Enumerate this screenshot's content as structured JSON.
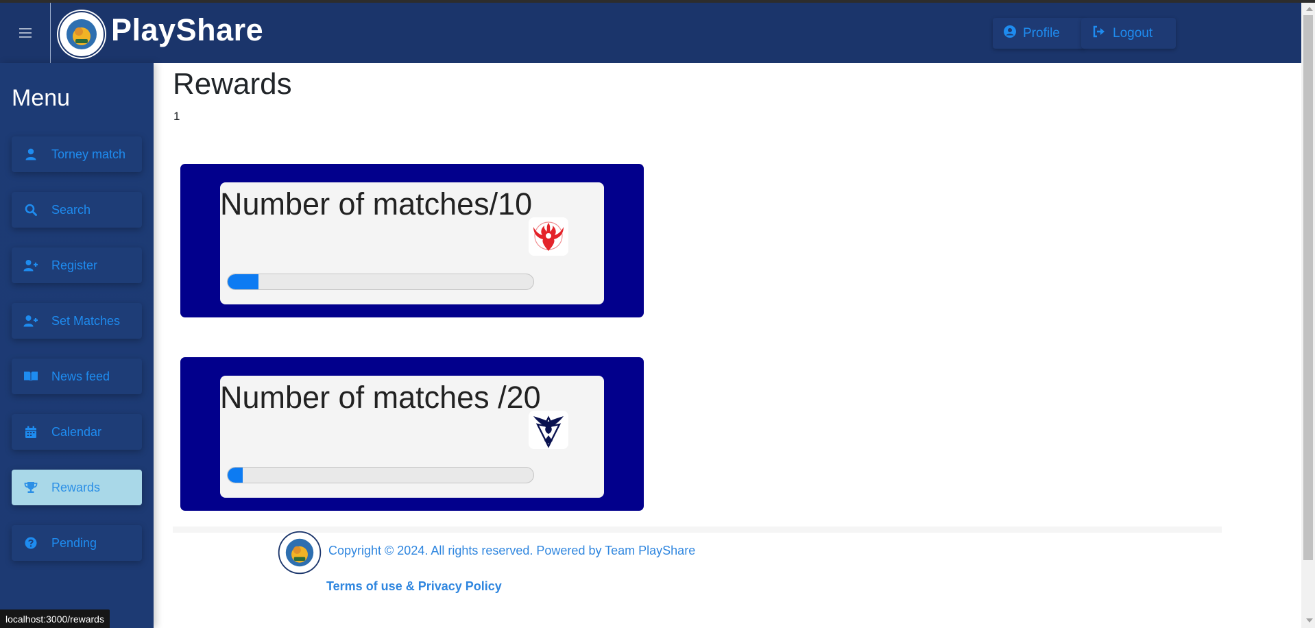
{
  "colors": {
    "header_bg": "#1b356b",
    "sidebar_bg": "#1d3b75",
    "accent_blue": "#1e8cf0",
    "active_nav_bg": "#a9d8e8",
    "card_bg": "#02008c",
    "progress_fill": "#0d7bf2"
  },
  "header": {
    "menu_icon": "hamburger-icon",
    "brand_name": "PlayShare",
    "profile_label": "Profile",
    "profile_icon": "user-circle-icon",
    "logout_label": "Logout",
    "logout_icon": "sign-out-icon"
  },
  "sidebar": {
    "title": "Menu",
    "items": [
      {
        "label": "Torney match",
        "icon": "user-icon",
        "active": false
      },
      {
        "label": "Search",
        "icon": "search-icon",
        "active": false
      },
      {
        "label": "Register",
        "icon": "user-plus-icon",
        "active": false
      },
      {
        "label": "Set Matches",
        "icon": "user-plus-icon",
        "active": false
      },
      {
        "label": "News feed",
        "icon": "book-open-icon",
        "active": false
      },
      {
        "label": "Calendar",
        "icon": "calendar-icon",
        "active": false
      },
      {
        "label": "Rewards",
        "icon": "trophy-icon",
        "active": true
      },
      {
        "label": "Pending",
        "icon": "question-circle-icon",
        "active": false
      }
    ]
  },
  "main": {
    "title": "Rewards",
    "count": "1",
    "rewards": [
      {
        "title": "Number of matches/10",
        "badge_icon": "team-valor-icon",
        "progress": 0.1
      },
      {
        "title": "Number of matches /20",
        "badge_icon": "team-mystic-icon",
        "progress": 0.05
      }
    ]
  },
  "footer": {
    "copyright": "Copyright © 2024. All rights reserved. Powered by Team PlayShare",
    "terms_link": "Terms of use & Privacy Policy"
  },
  "status_bar": {
    "url": "localhost:3000/rewards"
  }
}
